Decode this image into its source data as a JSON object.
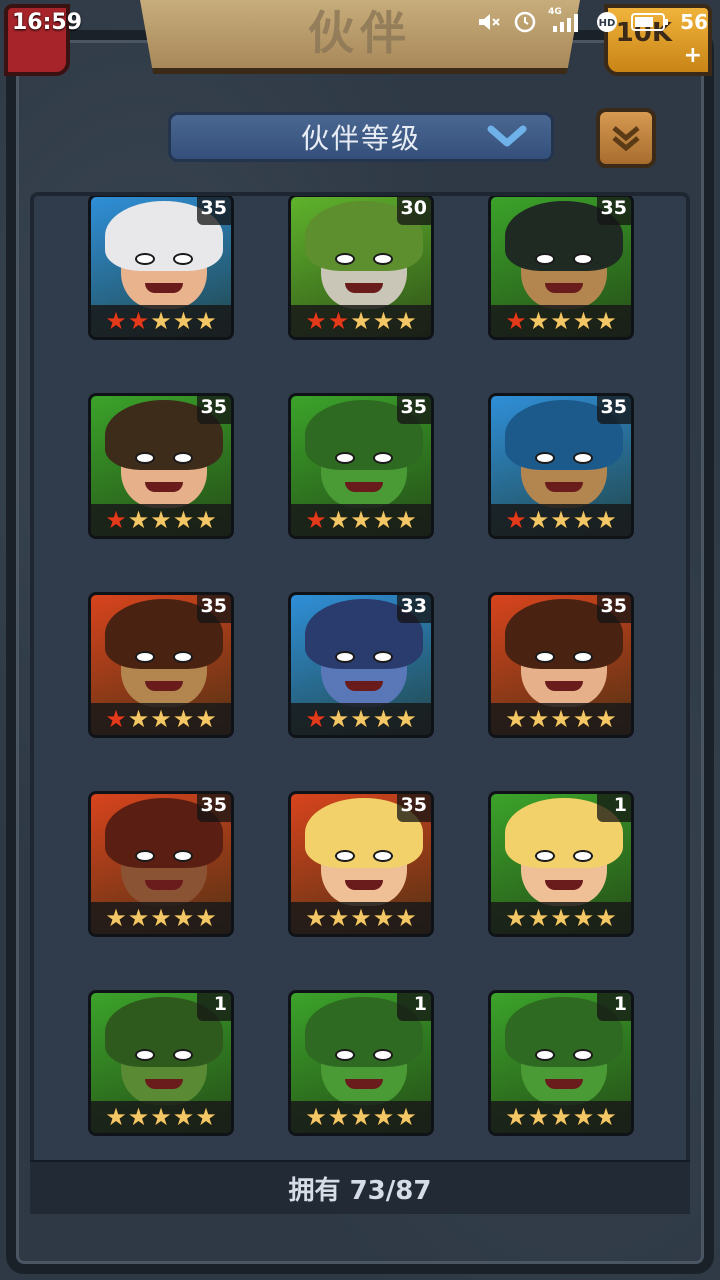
{
  "status": {
    "time": "16:59",
    "signal": "4G",
    "battery": "56"
  },
  "header": {
    "title": "伙伴",
    "gold_text": "10K"
  },
  "sort": {
    "label": "伙伴等级"
  },
  "footer": {
    "owned": "拥有 73/87"
  },
  "heroes": [
    {
      "level": "35",
      "stars": [
        "red",
        "red",
        "gold",
        "gold",
        "gold"
      ],
      "bg": "#2f8fd8",
      "hair": "#e8e8ea",
      "skin": "#e9b38d"
    },
    {
      "level": "30",
      "stars": [
        "red",
        "red",
        "gold",
        "gold",
        "gold"
      ],
      "bg": "#5fb32c",
      "hair": "#5e8f2e",
      "skin": "#c9c6b7"
    },
    {
      "level": "35",
      "stars": [
        "red",
        "gold",
        "gold",
        "gold",
        "gold"
      ],
      "bg": "#3ba32a",
      "hair": "#1f2a22",
      "skin": "#b4864f"
    },
    {
      "level": "35",
      "stars": [
        "red",
        "gold",
        "gold",
        "gold",
        "gold"
      ],
      "bg": "#3ba32a",
      "hair": "#3e2c1a",
      "skin": "#e6b08a"
    },
    {
      "level": "35",
      "stars": [
        "red",
        "gold",
        "gold",
        "gold",
        "gold"
      ],
      "bg": "#3ba32a",
      "hair": "#2f6a22",
      "skin": "#4a9a35"
    },
    {
      "level": "35",
      "stars": [
        "red",
        "gold",
        "gold",
        "gold",
        "gold"
      ],
      "bg": "#2f8fd8",
      "hair": "#1c5a8c",
      "skin": "#b4864f"
    },
    {
      "level": "35",
      "stars": [
        "red",
        "gold",
        "gold",
        "gold",
        "gold"
      ],
      "bg": "#d8441d",
      "hair": "#4a2212",
      "skin": "#b4864f"
    },
    {
      "level": "33",
      "stars": [
        "red",
        "gold",
        "gold",
        "gold",
        "gold"
      ],
      "bg": "#2f8fd8",
      "hair": "#2a3b6e",
      "skin": "#5a78b8"
    },
    {
      "level": "35",
      "stars": [
        "gold",
        "gold",
        "gold",
        "gold",
        "gold"
      ],
      "bg": "#d8441d",
      "hair": "#4a2212",
      "skin": "#e6b08a"
    },
    {
      "level": "35",
      "stars": [
        "gold",
        "gold",
        "gold",
        "gold",
        "gold"
      ],
      "bg": "#d8441d",
      "hair": "#5a1f12",
      "skin": "#8a5434"
    },
    {
      "level": "35",
      "stars": [
        "gold",
        "gold",
        "gold",
        "gold",
        "gold"
      ],
      "bg": "#d8441d",
      "hair": "#f2d16a",
      "skin": "#efc096"
    },
    {
      "level": "1",
      "stars": [
        "gold",
        "gold",
        "gold",
        "gold",
        "gold"
      ],
      "bg": "#3ba32a",
      "hair": "#f2d16a",
      "skin": "#efc096"
    },
    {
      "level": "1",
      "stars": [
        "gold",
        "gold",
        "gold",
        "gold",
        "gold"
      ],
      "bg": "#3ba32a",
      "hair": "#2f5a1e",
      "skin": "#5a8a34"
    },
    {
      "level": "1",
      "stars": [
        "gold",
        "gold",
        "gold",
        "gold",
        "gold"
      ],
      "bg": "#3ba32a",
      "hair": "#2f6a22",
      "skin": "#4a9a35"
    },
    {
      "level": "1",
      "stars": [
        "gold",
        "gold",
        "gold",
        "gold",
        "gold"
      ],
      "bg": "#3ba32a",
      "hair": "#2f6a22",
      "skin": "#4a9a35"
    }
  ]
}
